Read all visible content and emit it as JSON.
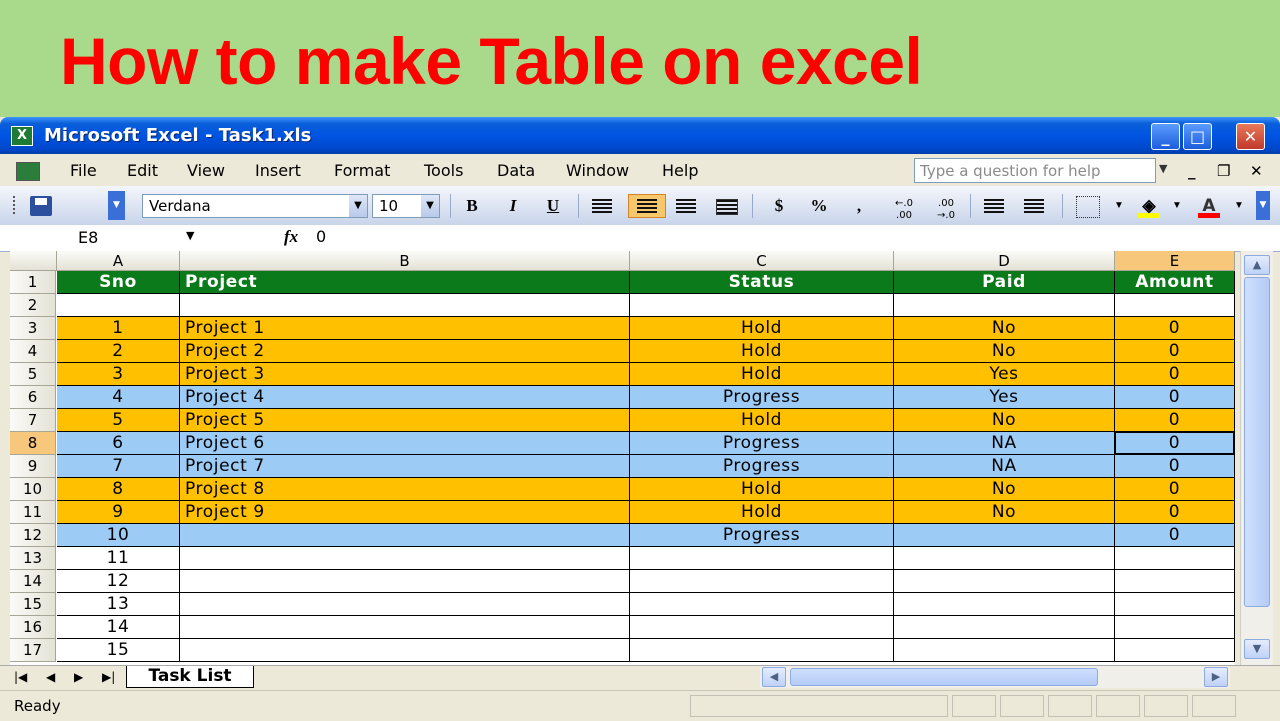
{
  "banner": {
    "title": "How to make Table on excel"
  },
  "window": {
    "title": "Microsoft Excel - Task1.xls",
    "app_icon": "X",
    "controls": {
      "minimize": "_",
      "maximize": "□",
      "close": "✕"
    }
  },
  "menu": {
    "items": [
      "File",
      "Edit",
      "View",
      "Insert",
      "Format",
      "Tools",
      "Data",
      "Window",
      "Help"
    ],
    "help_placeholder": "Type a question for help"
  },
  "toolbar": {
    "font_name": "Verdana",
    "font_size": "10",
    "bold": "B",
    "italic": "I",
    "underline": "U",
    "currency": "$",
    "percent": "%",
    "comma": ",",
    "inc_decimal": "←.0 .00",
    "dec_decimal": ".00 →.0",
    "fill_color": "#ffff00",
    "font_color": "#ff0000"
  },
  "formula_bar": {
    "name_box": "E8",
    "fx": "fx",
    "value": "0"
  },
  "sheet": {
    "columns": [
      "A",
      "B",
      "C",
      "D",
      "E"
    ],
    "selected_column": "E",
    "selected_row": "8",
    "header": [
      "Sno",
      "Project",
      "Status",
      "Paid",
      "Amount"
    ],
    "rows": [
      {
        "num": "2",
        "cells": [
          "",
          "",
          "",
          "",
          ""
        ],
        "color": "white"
      },
      {
        "num": "3",
        "cells": [
          "1",
          "Project 1",
          "Hold",
          "No",
          "0"
        ],
        "color": "gold"
      },
      {
        "num": "4",
        "cells": [
          "2",
          "Project 2",
          "Hold",
          "No",
          "0"
        ],
        "color": "gold"
      },
      {
        "num": "5",
        "cells": [
          "3",
          "Project 3",
          "Hold",
          "Yes",
          "0"
        ],
        "color": "gold"
      },
      {
        "num": "6",
        "cells": [
          "4",
          "Project 4",
          "Progress",
          "Yes",
          "0"
        ],
        "color": "blue"
      },
      {
        "num": "7",
        "cells": [
          "5",
          "Project 5",
          "Hold",
          "No",
          "0"
        ],
        "color": "gold"
      },
      {
        "num": "8",
        "cells": [
          "6",
          "Project 6",
          "Progress",
          "NA",
          "0"
        ],
        "color": "blue"
      },
      {
        "num": "9",
        "cells": [
          "7",
          "Project 7",
          "Progress",
          "NA",
          "0"
        ],
        "color": "blue"
      },
      {
        "num": "10",
        "cells": [
          "8",
          "Project 8",
          "Hold",
          "No",
          "0"
        ],
        "color": "gold"
      },
      {
        "num": "11",
        "cells": [
          "9",
          "Project 9",
          "Hold",
          "No",
          "0"
        ],
        "color": "gold"
      },
      {
        "num": "12",
        "cells": [
          "10",
          "",
          "Progress",
          "",
          "0"
        ],
        "color": "blue"
      },
      {
        "num": "13",
        "cells": [
          "11",
          "",
          "",
          "",
          ""
        ],
        "color": "white"
      },
      {
        "num": "14",
        "cells": [
          "12",
          "",
          "",
          "",
          ""
        ],
        "color": "white"
      },
      {
        "num": "15",
        "cells": [
          "13",
          "",
          "",
          "",
          ""
        ],
        "color": "white"
      },
      {
        "num": "16",
        "cells": [
          "14",
          "",
          "",
          "",
          ""
        ],
        "color": "white"
      },
      {
        "num": "17",
        "cells": [
          "15",
          "",
          "",
          "",
          ""
        ],
        "color": "white"
      }
    ],
    "colors": {
      "header_bg": "#0b7a1a",
      "gold": "#ffc000",
      "blue": "#9ccbf5"
    }
  },
  "tabs": {
    "active_tab": "Task List"
  },
  "status": {
    "text": "Ready"
  }
}
